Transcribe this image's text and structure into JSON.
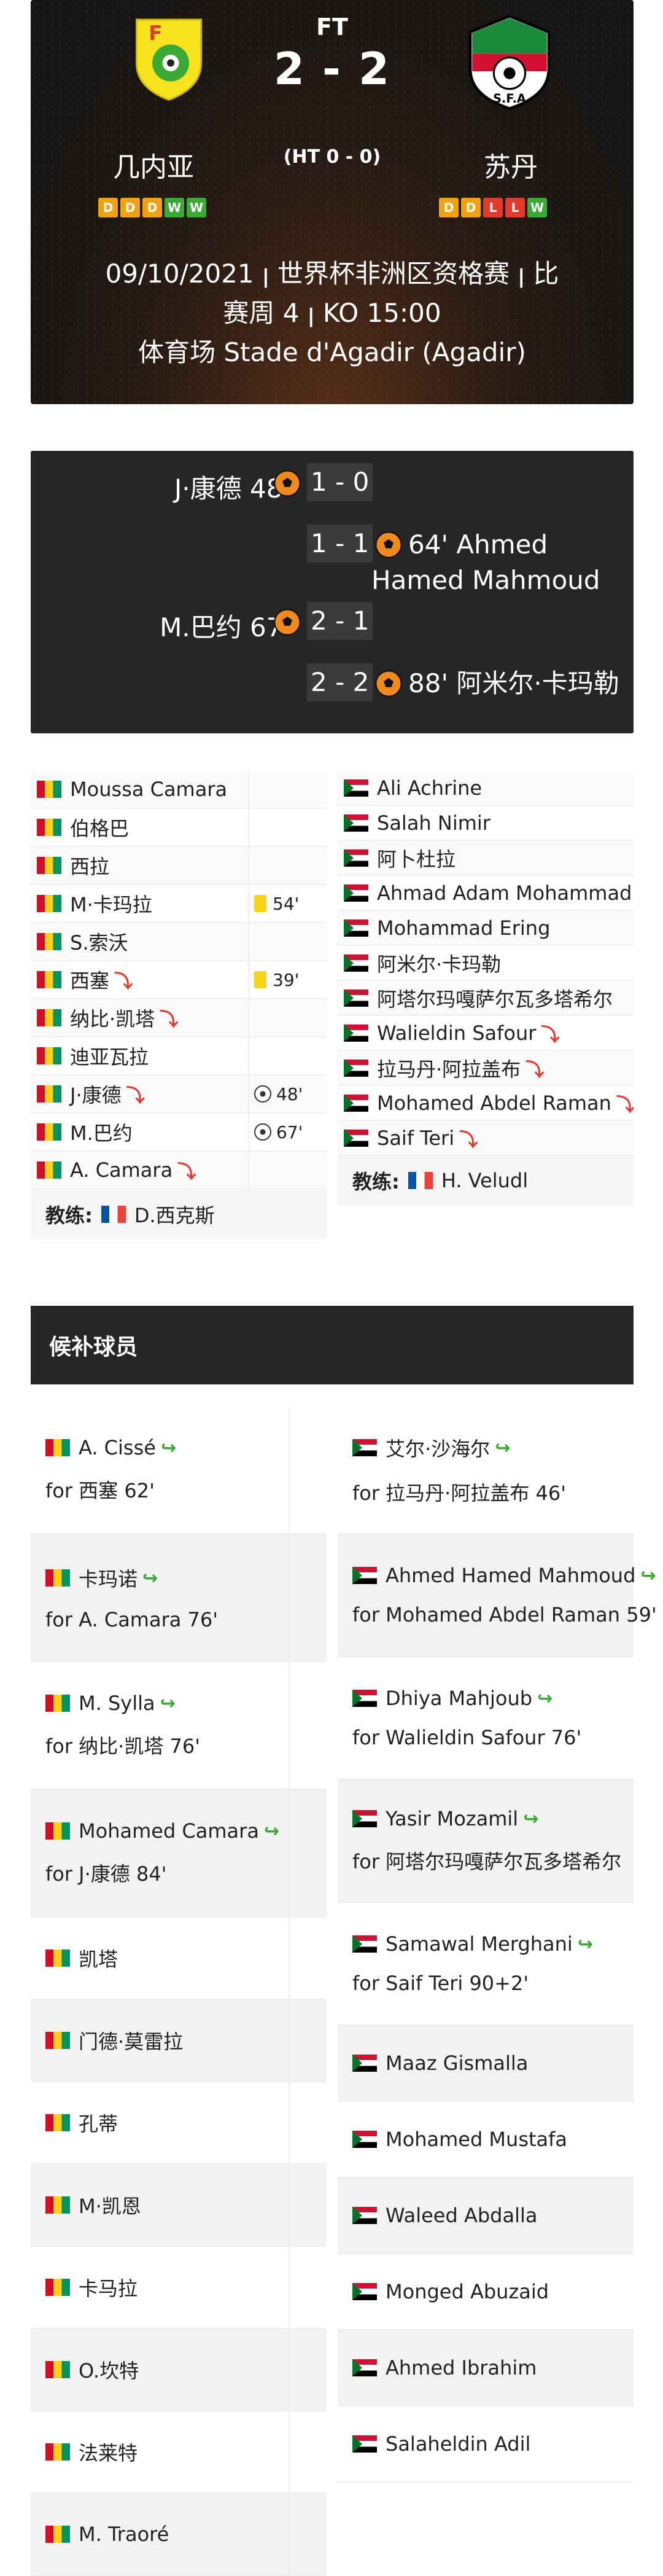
{
  "header": {
    "status": "FT",
    "score": "2 - 2",
    "halftime": "(HT 0 - 0)",
    "home_team": "几内亚",
    "away_team": "苏丹",
    "home_form": [
      "D",
      "D",
      "D",
      "W",
      "W"
    ],
    "away_form": [
      "D",
      "D",
      "L",
      "L",
      "W"
    ],
    "info_line1": "09/10/2021 ꞁ 世界杯非洲区资格赛 ꞁ 比",
    "info_line2": "赛周 4 ꞁ KO 15:00",
    "info_line3": "体育场 Stade d'Agadir (Agadir)",
    "away_badge_text": "S.F.A"
  },
  "goals": [
    {
      "side": "home",
      "text": "J·康德 48'",
      "score": "1 - 0"
    },
    {
      "side": "away",
      "text": "64' Ahmed Hamed Mahmoud",
      "score": "1 - 1"
    },
    {
      "side": "home",
      "text": "M.巴约 67'",
      "score": "2 - 1"
    },
    {
      "side": "away",
      "text": "88' 阿米尔·卡玛勒",
      "score": "2 - 2"
    }
  ],
  "home_lineup": [
    {
      "name": "Moussa Camara",
      "sub": false,
      "event": ""
    },
    {
      "name": "伯格巴",
      "sub": false,
      "event": ""
    },
    {
      "name": "西拉",
      "sub": false,
      "event": ""
    },
    {
      "name": "M·卡玛拉",
      "sub": false,
      "event": "54'",
      "event_type": "yellow"
    },
    {
      "name": "S.索沃",
      "sub": false,
      "event": ""
    },
    {
      "name": "西塞",
      "sub": true,
      "event": "39'",
      "event_type": "yellow"
    },
    {
      "name": "纳比·凯塔",
      "sub": true,
      "event": ""
    },
    {
      "name": "迪亚瓦拉",
      "sub": false,
      "event": ""
    },
    {
      "name": "J·康德",
      "sub": true,
      "event": "48'",
      "event_type": "goal"
    },
    {
      "name": "M.巴约",
      "sub": false,
      "event": "67'",
      "event_type": "goal"
    },
    {
      "name": "A. Camara",
      "sub": true,
      "event": ""
    }
  ],
  "away_lineup": [
    {
      "name": "Ali Achrine",
      "sub": false
    },
    {
      "name": "Salah Nimir",
      "sub": false
    },
    {
      "name": "阿卜杜拉",
      "sub": false
    },
    {
      "name": "Ahmad Adam Mohammad",
      "sub": false
    },
    {
      "name": "Mohammad Ering",
      "sub": false
    },
    {
      "name": "阿米尔·卡玛勒",
      "sub": false
    },
    {
      "name": "阿塔尔玛嘎萨尔瓦多塔希尔",
      "sub": false
    },
    {
      "name": "Walieldin Safour",
      "sub": true
    },
    {
      "name": "拉马丹·阿拉盖布",
      "sub": true
    },
    {
      "name": "Mohamed Abdel Raman",
      "sub": true
    },
    {
      "name": "Saif Teri",
      "sub": true
    }
  ],
  "home_coach_label": "教练:",
  "home_coach": "D.西克斯",
  "away_coach_label": "教练:",
  "away_coach": "H. Veludl",
  "subs_title": "候补球员",
  "home_subs": [
    {
      "name": "A. Cissé",
      "in": true,
      "for": "for 西塞 62'"
    },
    {
      "name": "卡玛诺",
      "in": true,
      "for": "for A. Camara 76'"
    },
    {
      "name": "M. Sylla",
      "in": true,
      "for": "for 纳比·凯塔 76'"
    },
    {
      "name": "Mohamed Camara",
      "in": true,
      "for": "for J·康德 84'"
    },
    {
      "name": "凯塔",
      "in": false,
      "for": ""
    },
    {
      "name": "门德·莫雷拉",
      "in": false,
      "for": ""
    },
    {
      "name": "孔蒂",
      "in": false,
      "for": ""
    },
    {
      "name": "M·凯恩",
      "in": false,
      "for": ""
    },
    {
      "name": "卡马拉",
      "in": false,
      "for": ""
    },
    {
      "name": "O.坎特",
      "in": false,
      "for": ""
    },
    {
      "name": "法莱特",
      "in": false,
      "for": ""
    },
    {
      "name": "M. Traoré",
      "in": false,
      "for": ""
    }
  ],
  "away_subs": [
    {
      "name": "艾尔·沙海尔",
      "in": true,
      "for": "for 拉马丹·阿拉盖布 46'"
    },
    {
      "name": "Ahmed Hamed Mahmoud",
      "in": true,
      "for": "for Mohamed Abdel Raman 59'"
    },
    {
      "name": "Dhiya Mahjoub",
      "in": true,
      "for": "for Walieldin Safour 76'"
    },
    {
      "name": "Yasir Mozamil",
      "in": true,
      "for": "for 阿塔尔玛嘎萨尔瓦多塔希尔"
    },
    {
      "name": "Samawal Merghani",
      "in": true,
      "for": "for Saif Teri 90+2'"
    },
    {
      "name": "Maaz Gismalla",
      "in": false,
      "for": ""
    },
    {
      "name": "Mohamed Mustafa",
      "in": false,
      "for": ""
    },
    {
      "name": "Waleed Abdalla",
      "in": false,
      "for": ""
    },
    {
      "name": "Monged Abuzaid",
      "in": false,
      "for": ""
    },
    {
      "name": "Ahmed Ibrahim",
      "in": false,
      "for": ""
    },
    {
      "name": "Salaheldin Adil",
      "in": false,
      "for": ""
    }
  ]
}
